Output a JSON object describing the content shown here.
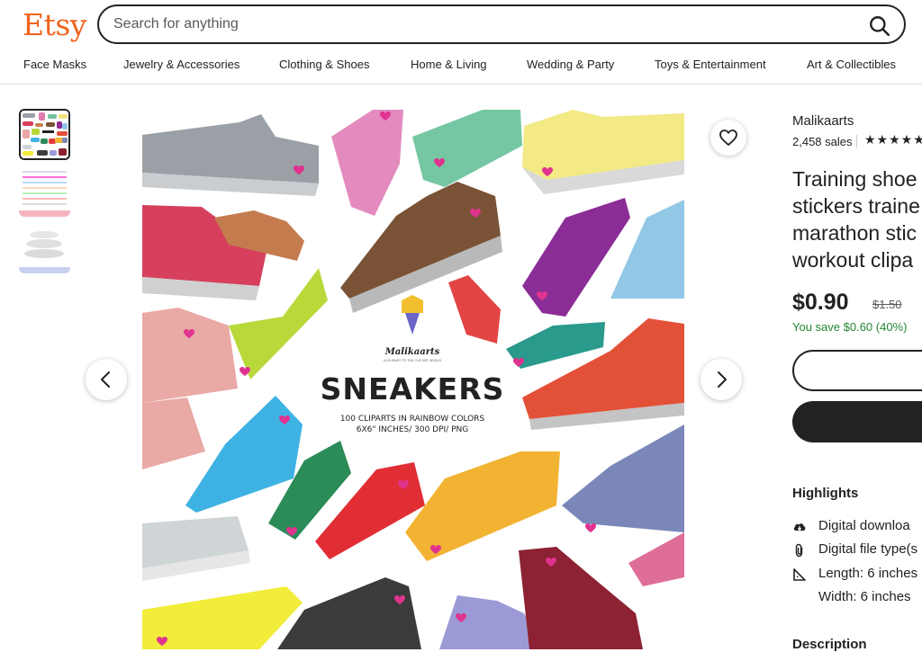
{
  "header": {
    "logo": "Etsy",
    "search": {
      "placeholder": "Search for anything",
      "value": ""
    },
    "categories": [
      "Face Masks",
      "Jewelry & Accessories",
      "Clothing & Shoes",
      "Home & Living",
      "Wedding & Party",
      "Toys & Entertainment",
      "Art & Collectibles"
    ]
  },
  "gallery": {
    "thumbnails": 3,
    "active_thumbnail": 1,
    "image": {
      "brand": "Malikaarts",
      "tagline": "A JOURNEY TO THE CLIP ART WORLD",
      "title": "SNEAKERS",
      "line1": "100 CLIPARTS IN RAINBOW COLORS",
      "line2": "6X6\" INCHES/ 300 DPI/ PNG"
    },
    "favorite_icon": "heart-outline-icon",
    "prev_icon": "chevron-left-icon",
    "next_icon": "chevron-right-icon"
  },
  "listing": {
    "shop_name": "Malikaarts",
    "sales": "2,458 sales",
    "stars": "★★★★★",
    "title_lines": [
      "Training shoe",
      "stickers traine",
      "marathon stic",
      "workout clipa"
    ],
    "price": "$0.90",
    "original_price": "$1.50",
    "savings": "You save $0.60 (40%)",
    "savings_color": "#258635",
    "highlights_title": "Highlights",
    "highlights": [
      {
        "icon": "cloud-download-icon",
        "text": "Digital downloa"
      },
      {
        "icon": "paperclip-icon",
        "text": "Digital file type(s"
      },
      {
        "icon": "ruler-icon",
        "text": "Length: 6 inches"
      },
      {
        "icon": "",
        "text": "Width: 6 inches"
      }
    ],
    "description_title": "Description"
  },
  "colors": {
    "brand": "#f1641e",
    "text": "#222222"
  }
}
